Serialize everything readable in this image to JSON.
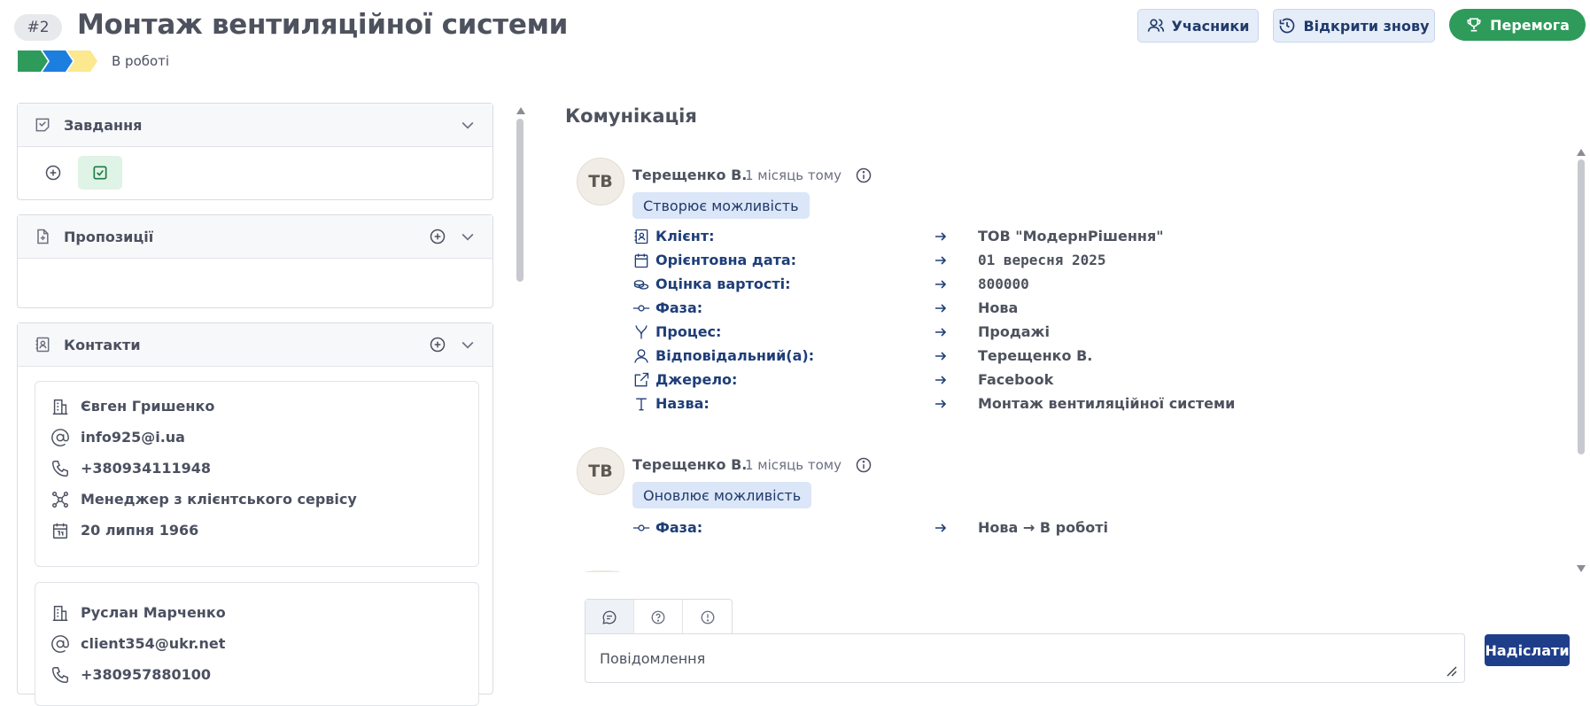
{
  "header": {
    "id_badge": "#2",
    "title": "Монтаж вентиляційної системи",
    "stage_label": "В роботі",
    "stage_colors": [
      "#2e9b5b",
      "#1c7fe0",
      "#fbe88f"
    ],
    "buttons": {
      "participants": "Учасники",
      "reopen": "Відкрити знову",
      "win": "Перемога"
    },
    "colors": {
      "win_bg": "#2e9b5b",
      "light_btn_bg": "#e5edf8",
      "send_bg": "#1f3e8a"
    }
  },
  "panels": {
    "tasks": {
      "title": "Завдання"
    },
    "proposals": {
      "title": "Пропозиції"
    },
    "contacts": {
      "title": "Контакти",
      "items": [
        {
          "name": "Євген Гришенко",
          "email": "info925@i.ua",
          "phone": "+380934111948",
          "role": "Менеджер з клієнтського сервісу",
          "birthday": "20 липня 1966"
        },
        {
          "name": "Руслан Марченко",
          "email": "client354@ukr.net",
          "phone": "+380957880100"
        }
      ]
    }
  },
  "communication": {
    "title": "Комунікація",
    "entries": [
      {
        "avatar": "ТВ",
        "author": "Терещенко В.",
        "time": "1 місяць тому",
        "action": "Створює можливість",
        "fields": [
          {
            "icon": "client-icon",
            "label": "Клієнт:",
            "value": "ТОВ \"МодернРішення\""
          },
          {
            "icon": "calendar-icon",
            "label": "Орієнтовна дата:",
            "value": "01 вересня 2025"
          },
          {
            "icon": "coins-icon",
            "label": "Оцінка вартості:",
            "value": "800000"
          },
          {
            "icon": "phase-icon",
            "label": "Фаза:",
            "value": "Нова"
          },
          {
            "icon": "process-icon",
            "label": "Процес:",
            "value": "Продажі"
          },
          {
            "icon": "user-icon",
            "label": "Відповідальний(а):",
            "value": "Терещенко В."
          },
          {
            "icon": "external-link-icon",
            "label": "Джерело:",
            "value": "Facebook"
          },
          {
            "icon": "text-icon",
            "label": "Назва:",
            "value": "Монтаж вентиляційної системи"
          }
        ]
      },
      {
        "avatar": "ТВ",
        "author": "Терещенко В.",
        "time": "1 місяць тому",
        "action": "Оновлює можливість",
        "fields": [
          {
            "icon": "phase-icon",
            "label": "Фаза:",
            "value": "Нова → В роботі"
          }
        ]
      }
    ]
  },
  "composer": {
    "placeholder": "Повідомлення",
    "send_label": "Надіслати"
  }
}
